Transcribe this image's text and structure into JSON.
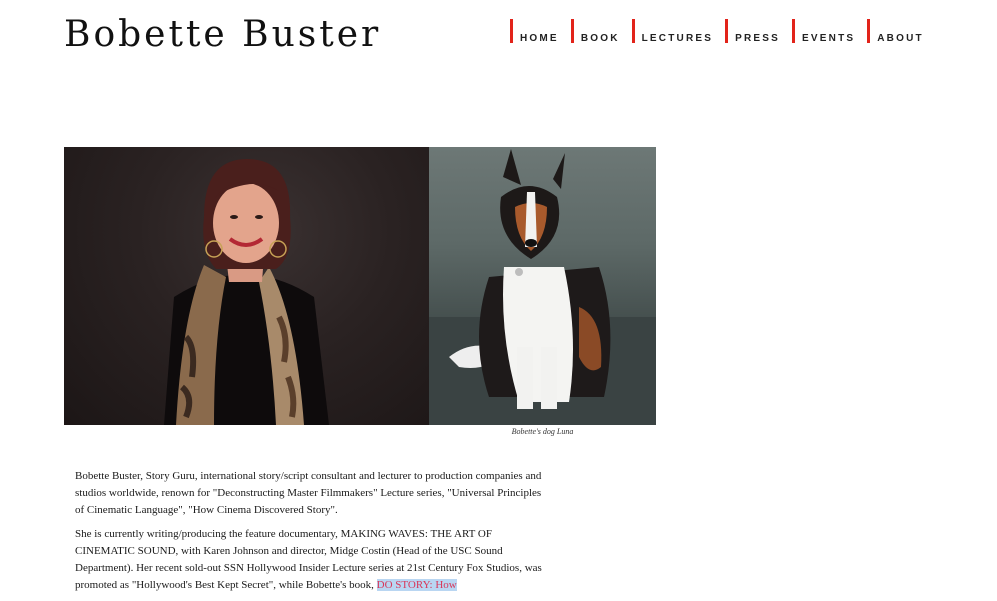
{
  "site": {
    "title": "Bobette Buster"
  },
  "nav": {
    "items": [
      {
        "label": "HOME"
      },
      {
        "label": "BOOK"
      },
      {
        "label": "LECTURES"
      },
      {
        "label": "PRESS"
      },
      {
        "label": "EVENTS"
      },
      {
        "label": "ABOUT"
      }
    ],
    "accent_color": "#e2231a"
  },
  "photos": {
    "caption": "Bobette's dog Luna"
  },
  "bio": {
    "p1": "Bobette Buster, Story Guru, international story/script consultant and lecturer to production companies and studios worldwide, renown for \"Deconstructing Master Filmmakers\" Lecture series, \"Universal Principles of Cinematic Language\", \"How Cinema Discovered Story\".",
    "p2_text": "She is currently writing/producing the feature documentary, MAKING WAVES: THE ART OF CINEMATIC SOUND, with Karen Johnson and director, Midge Costin (Head of the USC Sound Department). Her recent sold-out SSN Hollywood Insider Lecture series at 21st Century Fox Studios, was promoted as \"Hollywood's Best Kept Secret\", while Bobette's book, ",
    "p2_link": "DO STORY: How",
    "link_color": "#d9375a",
    "highlight_color": "#b9d6f2"
  }
}
